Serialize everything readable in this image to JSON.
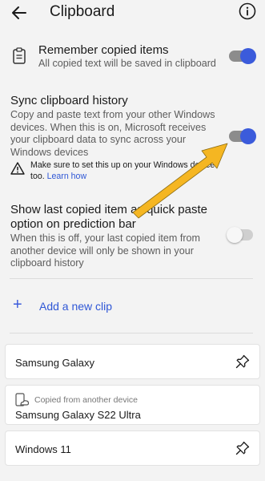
{
  "header": {
    "title": "Clipboard",
    "back_icon": "back-arrow-icon",
    "info_icon": "info-icon"
  },
  "remember": {
    "title": "Remember copied items",
    "description": "All copied text will be saved in clipboard",
    "icon": "clipboard-icon",
    "toggle_on": true
  },
  "sync": {
    "title": "Sync clipboard history",
    "description_lines": [
      "Copy and paste text from your other Windows",
      "devices. When this is on, Microsoft receives",
      "your clipboard data to sync across your",
      "Windows devices"
    ],
    "toggle_on": true,
    "warning_line1": "Make sure to set this up on your Windows device",
    "warning_line2_prefix": "too. ",
    "warning_link": "Learn how",
    "warning_icon": "warning-icon"
  },
  "quick_paste": {
    "title_lines": [
      "Show last copied item as quick paste",
      "option on prediction bar"
    ],
    "description_lines": [
      "When this is off, your last copied item from",
      "another device will only be shown in your",
      "clipboard history"
    ],
    "toggle_on": false
  },
  "add_clip": {
    "label": "Add a new clip"
  },
  "clips": [
    {
      "title": "Samsung Galaxy",
      "pinned_icon": "pin-icon"
    },
    {
      "subtitle": "Copied from another device",
      "title": "Samsung Galaxy S22 Ultra",
      "icon": "cloud-device-icon"
    },
    {
      "title": "Windows 11",
      "pinned_icon": "pin-icon"
    }
  ],
  "colors": {
    "accent": "#3b5bdb",
    "annotation_arrow": "#f5b622",
    "background": "#f3f3f3"
  }
}
